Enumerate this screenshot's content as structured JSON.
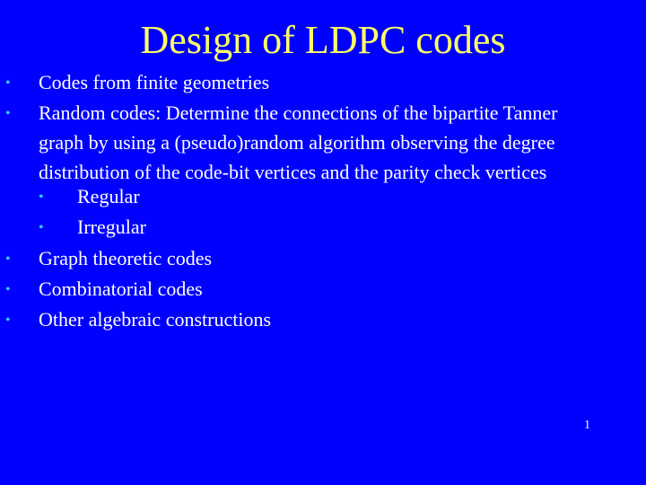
{
  "slide": {
    "title": "Design of LDPC codes",
    "bullet_glyph": "•",
    "items": [
      {
        "text": "Codes from finite geometries",
        "level": 1
      },
      {
        "lines": [
          "Random codes: Determine the connections of the bipartite Tanner",
          "graph by using a (pseudo)random algorithm observing the degree",
          "distribution of the code-bit vertices and the parity check vertices"
        ],
        "level": 1
      },
      {
        "text": "Regular",
        "level": 2
      },
      {
        "text": "Irregular",
        "level": 2
      },
      {
        "text": "Graph theoretic codes",
        "level": 1
      },
      {
        "text": "Combinatorial codes",
        "level": 1
      },
      {
        "text": "Other algebraic constructions",
        "level": 1
      }
    ],
    "page_number": "1"
  }
}
